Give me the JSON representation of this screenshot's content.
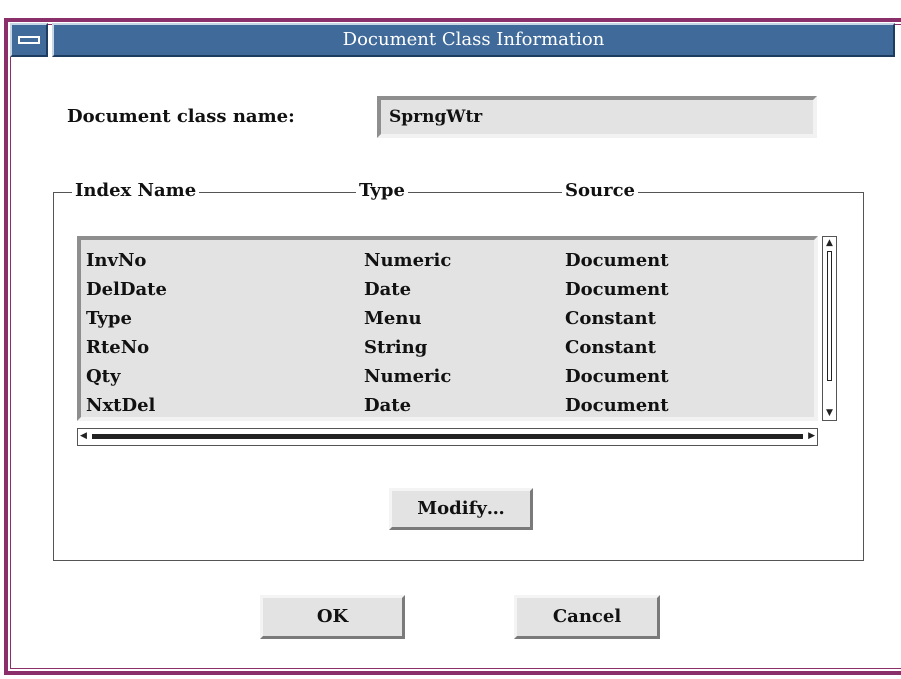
{
  "window": {
    "title": "Document Class Information"
  },
  "form": {
    "class_name_label": "Document class name:",
    "class_name_value": "SprngWtr"
  },
  "index_table": {
    "columns": [
      "Index Name",
      "Type",
      "Source"
    ],
    "rows": [
      [
        "InvNo",
        "Numeric",
        "Document"
      ],
      [
        "DelDate",
        "Date",
        "Document"
      ],
      [
        "Type",
        "Menu",
        "Constant"
      ],
      [
        "RteNo",
        "String",
        "Constant"
      ],
      [
        "Qty",
        "Numeric",
        "Document"
      ],
      [
        "NxtDel",
        "Date",
        "Document"
      ]
    ]
  },
  "buttons": {
    "modify": "Modify…",
    "ok": "OK",
    "cancel": "Cancel"
  },
  "colors": {
    "titlebar": "#3f6a9a",
    "frame": "#8a2f6a"
  }
}
